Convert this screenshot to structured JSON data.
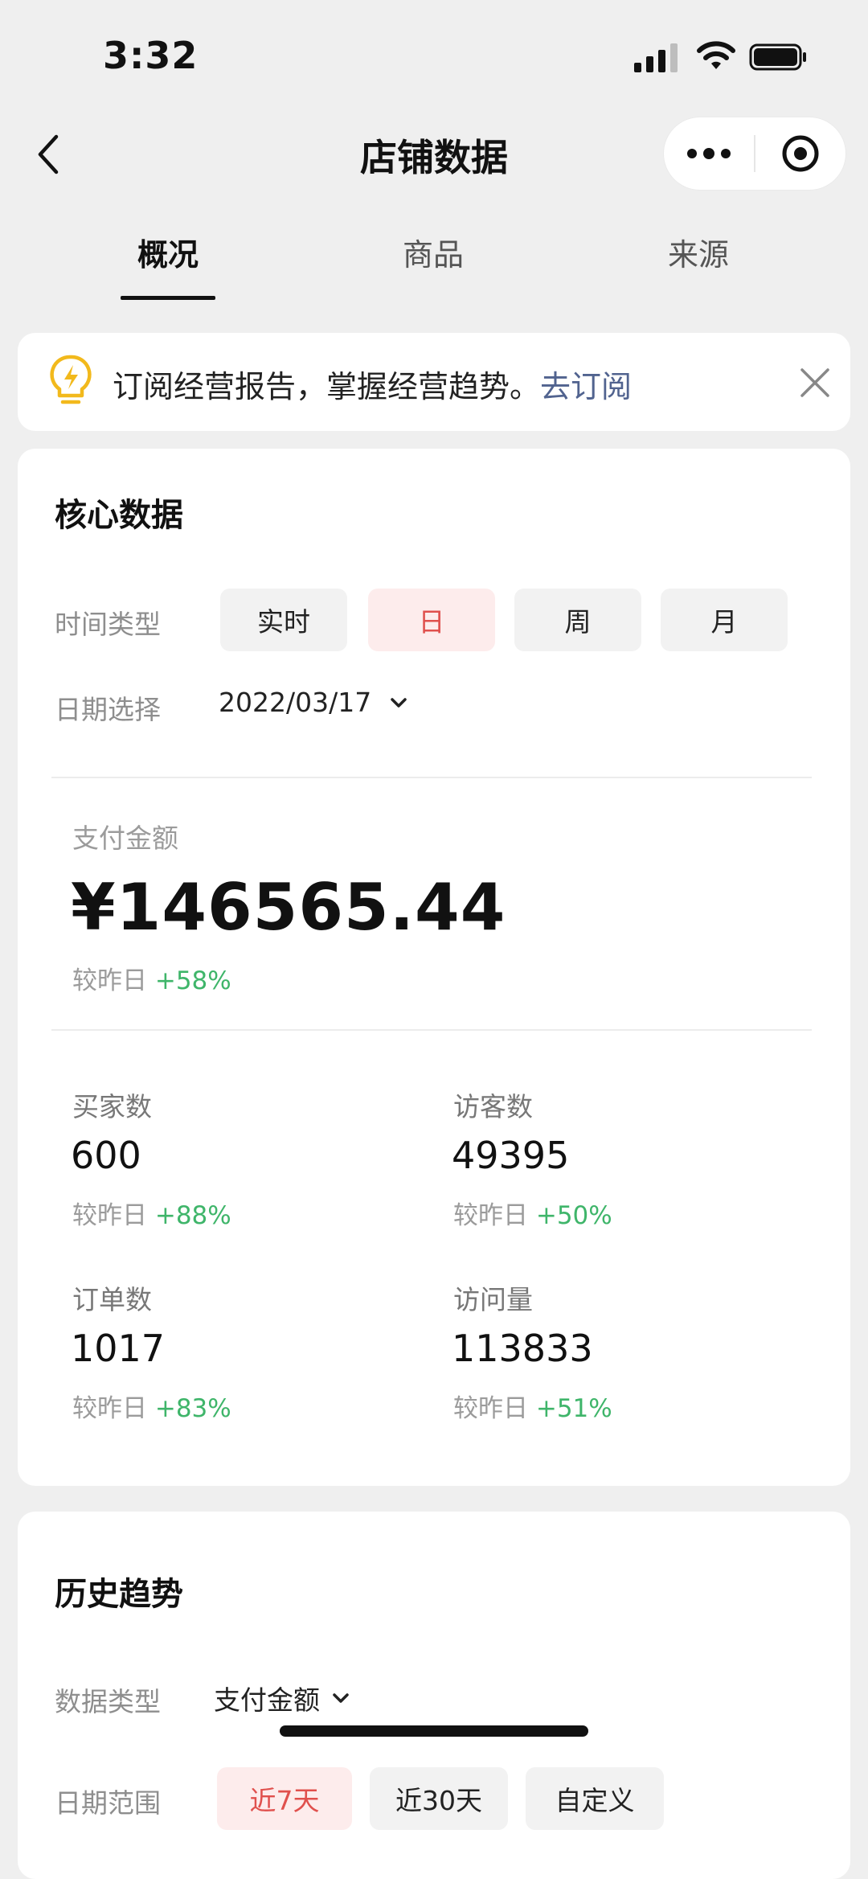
{
  "status_bar": {
    "time": "3:32"
  },
  "nav": {
    "title": "店铺数据"
  },
  "tabs": [
    {
      "label": "概况",
      "active": true
    },
    {
      "label": "商品",
      "active": false
    },
    {
      "label": "来源",
      "active": false
    }
  ],
  "banner": {
    "text": "订阅经营报告，掌握经营趋势。",
    "link": "去订阅"
  },
  "core": {
    "title": "核心数据",
    "time_type_label": "时间类型",
    "time_types": [
      "实时",
      "日",
      "周",
      "月"
    ],
    "selected_time_type": "日",
    "date_label": "日期选择",
    "date_value": "2022/03/17",
    "payment": {
      "label": "支付金额",
      "value": "¥146565.44",
      "cmp_label": "较昨日",
      "cmp_value": "+58%"
    },
    "metrics": [
      {
        "label": "买家数",
        "value": "600",
        "cmp_label": "较昨日",
        "cmp_value": "+88%"
      },
      {
        "label": "访客数",
        "value": "49395",
        "cmp_label": "较昨日",
        "cmp_value": "+50%"
      },
      {
        "label": "订单数",
        "value": "1017",
        "cmp_label": "较昨日",
        "cmp_value": "+83%"
      },
      {
        "label": "访问量",
        "value": "113833",
        "cmp_label": "较昨日",
        "cmp_value": "+51%"
      }
    ]
  },
  "history": {
    "title": "历史趋势",
    "data_type_label": "数据类型",
    "data_type_value": "支付金额",
    "range_label": "日期范围",
    "ranges": [
      "近7天",
      "近30天",
      "自定义"
    ],
    "selected_range": "近7天"
  },
  "colors": {
    "accent_red": "#e0504d",
    "accent_red_bg": "#fdecec",
    "up_green": "#3fb56a",
    "link_blue": "#51638f",
    "bulb_yellow": "#f2b91c"
  }
}
